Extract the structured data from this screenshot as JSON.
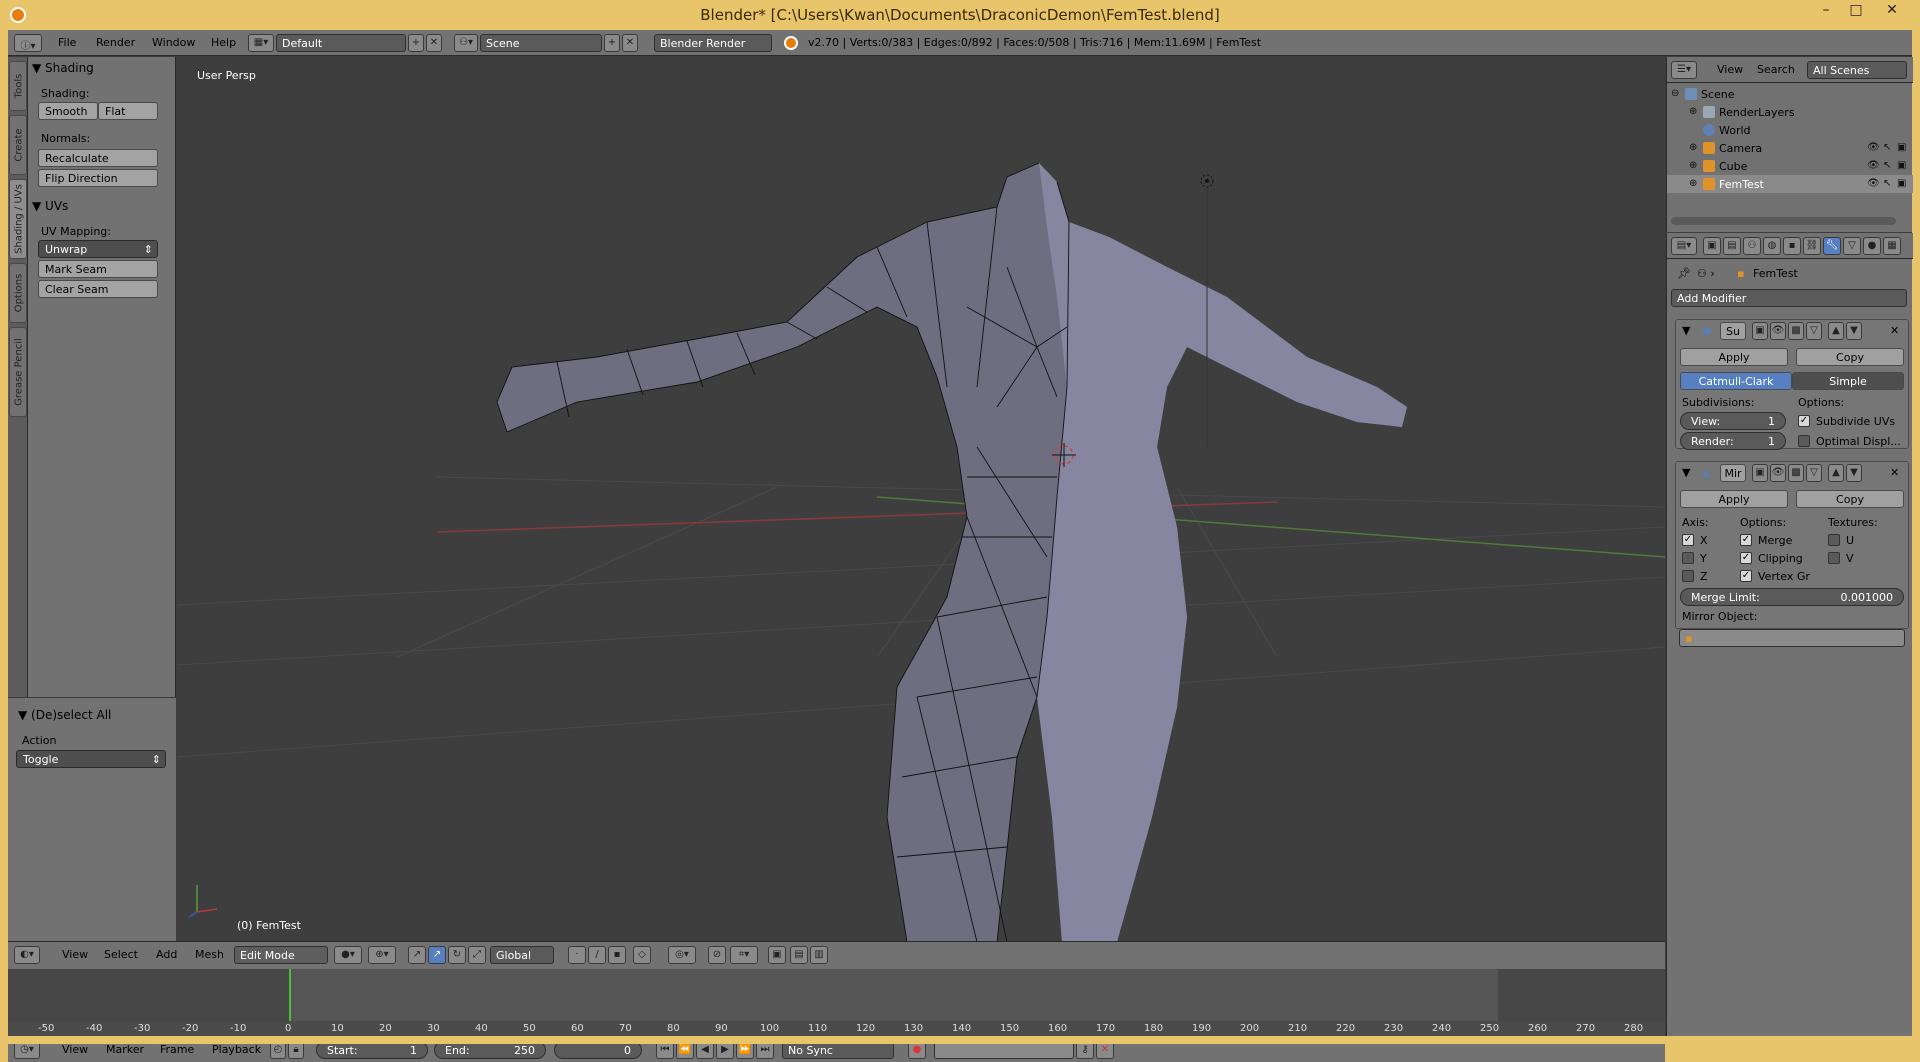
{
  "window": {
    "title": "Blender* [C:\\Users\\Kwan\\Documents\\DraconicDemon\\FemTest.blend]",
    "controls": [
      "–",
      "□",
      "✕"
    ]
  },
  "info_header": {
    "menus": [
      "File",
      "Render",
      "Window",
      "Help"
    ],
    "screen_layout": "Default",
    "scene": "Scene",
    "engine": "Blender Render",
    "stats": "v2.70 | Verts:0/383 | Edges:0/892 | Faces:0/508 | Tris:716 | Mem:11.69M | FemTest"
  },
  "tool_tabs": [
    "Tools",
    "Create",
    "Shading / UVs",
    "Options",
    "Grease Pencil"
  ],
  "shelf": {
    "shading_panel": "Shading",
    "shading_label": "Shading:",
    "smooth": "Smooth",
    "flat": "Flat",
    "normals_label": "Normals:",
    "recalculate": "Recalculate",
    "flip_direction": "Flip Direction",
    "uvs_panel": "UVs",
    "uv_mapping_label": "UV Mapping:",
    "unwrap": "Unwrap",
    "mark_seam": "Mark Seam",
    "clear_seam": "Clear Seam",
    "operator_panel": "(De)select All",
    "action_label": "Action",
    "action_value": "Toggle"
  },
  "viewport": {
    "view_label": "User Persp",
    "object_label": "(0) FemTest"
  },
  "viewport_header": {
    "menus": [
      "View",
      "Select",
      "Add",
      "Mesh"
    ],
    "mode": "Edit Mode",
    "orientation": "Global"
  },
  "timeline": {
    "ticks": [
      "-50",
      "-40",
      "-30",
      "-20",
      "-10",
      "0",
      "10",
      "20",
      "30",
      "40",
      "50",
      "60",
      "70",
      "80",
      "90",
      "100",
      "110",
      "120",
      "130",
      "140",
      "150",
      "160",
      "170",
      "180",
      "190",
      "200",
      "210",
      "220",
      "230",
      "240",
      "250",
      "260",
      "270",
      "280"
    ],
    "menus": [
      "View",
      "Marker",
      "Frame",
      "Playback"
    ],
    "start_label": "Start:",
    "start_value": "1",
    "end_label": "End:",
    "end_value": "250",
    "current_frame": "0",
    "sync": "No Sync",
    "current_frame_number": 0
  },
  "outliner": {
    "menus": [
      "View",
      "Search"
    ],
    "filter": "All Scenes",
    "rows": [
      {
        "name": "Scene",
        "icon": "scene-icon",
        "color": "#6f8fb8"
      },
      {
        "name": "RenderLayers",
        "icon": "renderlayers-icon",
        "color": "#9aa7b5"
      },
      {
        "name": "World",
        "icon": "world-icon",
        "color": "#5f80b0"
      },
      {
        "name": "Camera",
        "icon": "camera-icon",
        "color": "#e0922c"
      },
      {
        "name": "Cube",
        "icon": "mesh-icon",
        "color": "#e0922c"
      },
      {
        "name": "FemTest",
        "icon": "mesh-icon",
        "color": "#e0922c"
      }
    ]
  },
  "properties": {
    "object_name": "FemTest",
    "add_modifier": "Add Modifier",
    "subsurf": {
      "name": "Su",
      "apply": "Apply",
      "copy": "Copy",
      "catmull": "Catmull-Clark",
      "simple": "Simple",
      "subdivisions_label": "Subdivisions:",
      "options_label": "Options:",
      "view_label": "View:",
      "view_value": "1",
      "render_label": "Render:",
      "render_value": "1",
      "subdivide_uvs": "Subdivide UVs",
      "optimal_display": "Optimal Displ..."
    },
    "mirror": {
      "name": "Mir",
      "apply": "Apply",
      "copy": "Copy",
      "axis_label": "Axis:",
      "options_label": "Options:",
      "textures_label": "Textures:",
      "x": "X",
      "y": "Y",
      "z": "Z",
      "merge": "Merge",
      "clipping": "Clipping",
      "vertex_groups": "Vertex Gr",
      "u": "U",
      "v": "V",
      "merge_limit_label": "Merge Limit:",
      "merge_limit_value": "0.001000",
      "mirror_object_label": "Mirror Object:"
    }
  },
  "colors": {
    "title_bar": "#e8c46a",
    "panel_gray": "#727272",
    "viewport_bg": "#3e3e3e",
    "accent_blue": "#5680c2",
    "object_orange": "#e0922c"
  }
}
